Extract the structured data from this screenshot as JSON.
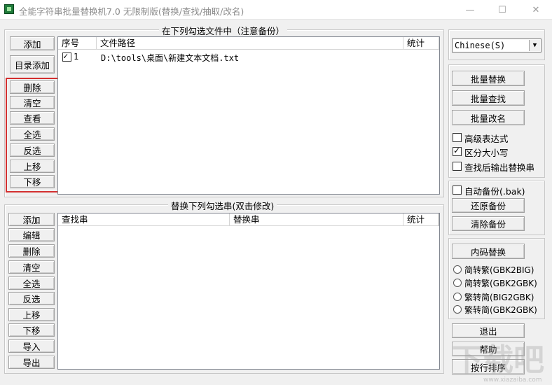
{
  "window": {
    "title": "全能字符串批量替换机7.0 无限制版(替换/查找/抽取/改名)",
    "minimize_glyph": "—",
    "maximize_glyph": "☐",
    "close_glyph": "✕"
  },
  "files_panel": {
    "group_title": "在下列勾选文件中（注意备份）",
    "buttons": [
      "添加",
      "目录添加",
      "删除",
      "清空",
      "查看",
      "全选",
      "反选",
      "上移",
      "下移"
    ],
    "columns": [
      "序号",
      "文件路径",
      "统计"
    ],
    "rows": [
      {
        "checked": true,
        "index": "1",
        "path": "D:\\tools\\桌面\\新建文本文档.txt",
        "count": ""
      }
    ],
    "highlight_color": "#d32f2f"
  },
  "replace_panel": {
    "group_title": "替换下列勾选串(双击修改)",
    "buttons": [
      "添加",
      "编辑",
      "删除",
      "清空",
      "全选",
      "反选",
      "上移",
      "下移",
      "导入",
      "导出"
    ],
    "columns": [
      "查找串",
      "替换串",
      "统计"
    ]
  },
  "right_panel": {
    "language_select": "Chinese(S)",
    "batch_buttons": [
      "批量替换",
      "批量查找",
      "批量改名"
    ],
    "options": [
      {
        "label": "高级表达式",
        "checked": false
      },
      {
        "label": "区分大小写",
        "checked": true
      },
      {
        "label": "查找后输出替换串",
        "checked": false
      }
    ],
    "backup": {
      "auto_label": "自动备份(.bak)",
      "auto_checked": false,
      "restore": "还原备份",
      "clear": "清除备份"
    },
    "encoding": {
      "button": "内码替换",
      "radios": [
        "简转繁(GBK2BIG)",
        "简转繁(GBK2GBK)",
        "繁转简(BIG2GBK)",
        "繁转简(GBK2GBK)"
      ]
    },
    "bottom_buttons": [
      "退出",
      "帮助",
      "按行排序"
    ]
  },
  "watermark": {
    "text": "下载吧",
    "url": "www.xiazaiba.com"
  }
}
